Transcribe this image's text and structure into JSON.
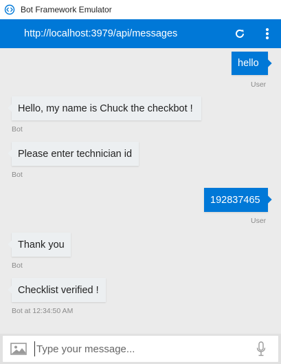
{
  "window": {
    "title": "Bot Framework Emulator"
  },
  "address_bar": {
    "url": "http://localhost:3979/api/messages"
  },
  "messages": [
    {
      "from": "user",
      "text": "hello",
      "meta": "User"
    },
    {
      "from": "bot",
      "text": "Hello, my name is Chuck the checkbot !",
      "meta": "Bot"
    },
    {
      "from": "bot",
      "text": "Please enter technician id",
      "meta": "Bot"
    },
    {
      "from": "user",
      "text": "192837465",
      "meta": "User"
    },
    {
      "from": "bot",
      "text": "Thank you",
      "meta": "Bot"
    },
    {
      "from": "bot",
      "text": "Checklist verified !",
      "meta": "Bot at 12:34:50 AM"
    }
  ],
  "composer": {
    "placeholder": "Type your message..."
  },
  "icons": {
    "app": "bot-framework-logo-icon",
    "refresh": "refresh-icon",
    "menu": "more-vertical-icon",
    "image": "image-upload-icon",
    "mic": "microphone-icon"
  },
  "colors": {
    "accent": "#0078d7",
    "bot_bubble": "#eceff1",
    "background": "#ebebeb"
  }
}
